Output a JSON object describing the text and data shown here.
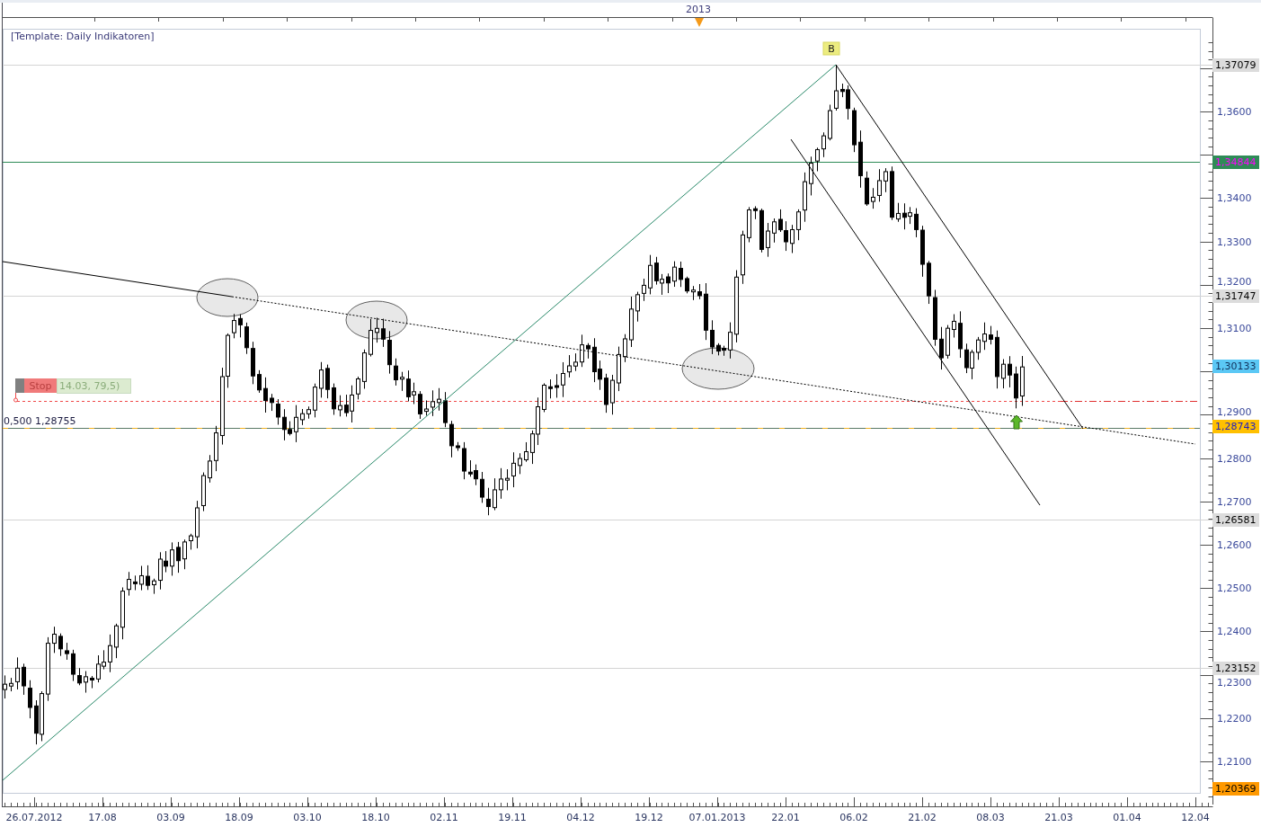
{
  "chart": {
    "template_label": "[Template: Daily Indikatoren]",
    "year_marker": "2013",
    "pattern_label": "B",
    "stop_order": {
      "label": "Stop",
      "detail": "14.03, 79,5)"
    },
    "fib_level_label": "0,500 1,28755",
    "price_axis": {
      "labels": [
        "1,3600",
        "1,3400",
        "1,3300",
        "1,3200",
        "1,3100",
        "1,2900",
        "1,2800",
        "1,2700",
        "1,2600",
        "1,2500",
        "1,2400",
        "1,2300",
        "1,2200",
        "1,2100"
      ]
    },
    "price_tags": [
      {
        "text": "1,37079",
        "kind": "marker",
        "color": "#dcdcdc"
      },
      {
        "text": "1,34844",
        "kind": "line",
        "color": "#2e8b57"
      },
      {
        "text": "1,31747",
        "kind": "marker",
        "color": "#dcdcdc"
      },
      {
        "text": "1,30133",
        "kind": "last",
        "color": "#5bc8f5"
      },
      {
        "text": "1,28743",
        "kind": "fib",
        "color": "#ffc000"
      },
      {
        "text": "1,26581",
        "kind": "marker",
        "color": "#dcdcdc"
      },
      {
        "text": "1,23152",
        "kind": "marker",
        "color": "#dcdcdc"
      },
      {
        "text": "1,20369",
        "kind": "bound",
        "color": "#ff9900"
      }
    ],
    "time_axis": {
      "labels": [
        "26.07.2012",
        "17.08",
        "03.09",
        "18.09",
        "03.10",
        "18.10",
        "02.11",
        "19.11",
        "04.12",
        "19.12",
        "07.01.2013",
        "22.01",
        "06.02",
        "21.02",
        "08.03",
        "21.03",
        "01.04",
        "12.04"
      ]
    }
  }
}
